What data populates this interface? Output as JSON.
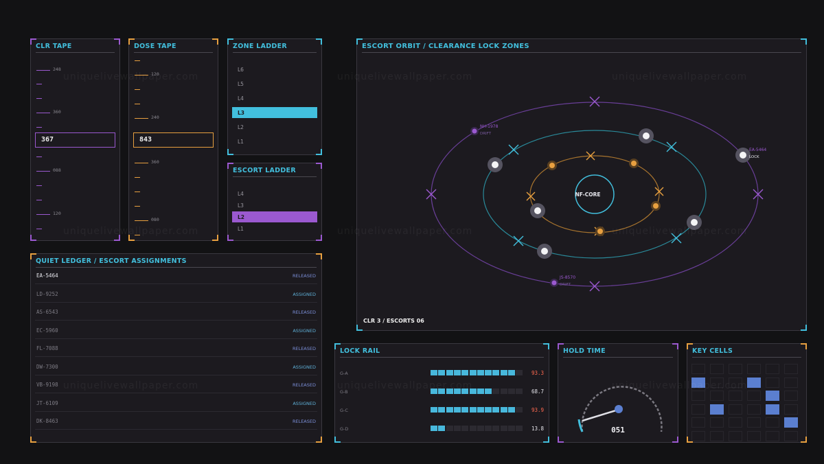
{
  "clr_tape": {
    "title": "CLR TAPE",
    "ticks": [
      "248",
      "",
      "",
      "360",
      "",
      "",
      "088",
      "",
      "",
      "120",
      "",
      ""
    ],
    "value": "367"
  },
  "dose_tape": {
    "title": "DOSE TAPE",
    "ticks_top": [
      "",
      "120",
      "",
      "",
      "240"
    ],
    "ticks_bottom": [
      "360",
      "",
      "",
      "",
      "080",
      ""
    ],
    "value": "843"
  },
  "zone_ladder": {
    "title": "ZONE LADDER",
    "levels": [
      "L6",
      "L5",
      "L4",
      "L3",
      "L2",
      "L1"
    ],
    "active": "L3"
  },
  "escort_ladder": {
    "title": "ESCORT LADDER",
    "levels": [
      "L4",
      "L3",
      "L2",
      "L1"
    ],
    "active": "L2"
  },
  "ledger": {
    "title": "QUIET LEDGER / ESCORT ASSIGNMENTS",
    "rows": [
      {
        "id": "EA-5464",
        "status": "RELEASED"
      },
      {
        "id": "LD-9252",
        "status": "ASSIGNED"
      },
      {
        "id": "AS-6543",
        "status": "RELEASED"
      },
      {
        "id": "EC-5960",
        "status": "ASSIGNED"
      },
      {
        "id": "FL-7088",
        "status": "RELEASED"
      },
      {
        "id": "DW-7300",
        "status": "ASSIGNED"
      },
      {
        "id": "VB-9198",
        "status": "RELEASED"
      },
      {
        "id": "JT-6109",
        "status": "ASSIGNED"
      },
      {
        "id": "DK-8463",
        "status": "RELEASED"
      }
    ]
  },
  "orbit": {
    "title": "ESCORT ORBIT / CLEARANCE LOCK ZONES",
    "core_label": "NF-CORE",
    "footer": "CLR 3 / ESCORTS 06",
    "tags": [
      {
        "id": "NH-1978",
        "state": "DRIFT"
      },
      {
        "id": "EA-5464",
        "state": "LOCK"
      },
      {
        "id": "JS-8570",
        "state": "DRIFT"
      }
    ]
  },
  "lock_rail": {
    "title": "LOCK RAIL",
    "rows": [
      {
        "label": "G-A",
        "value": "93.3",
        "filled": 11,
        "alert": true
      },
      {
        "label": "G-B",
        "value": "68.7",
        "filled": 8,
        "alert": false
      },
      {
        "label": "G-C",
        "value": "93.9",
        "filled": 11,
        "alert": true
      },
      {
        "label": "G-D",
        "value": "13.8",
        "filled": 2,
        "alert": false
      }
    ],
    "total_cells": 12
  },
  "hold_time": {
    "title": "HOLD TIME",
    "value": "051"
  },
  "key_cells": {
    "title": "KEY CELLS",
    "active": [
      [
        0,
        0
      ],
      [
        3,
        0
      ],
      [
        4,
        1
      ],
      [
        1,
        2
      ],
      [
        4,
        2
      ],
      [
        5,
        3
      ]
    ]
  },
  "watermark": "uniquelivewallpaper.com",
  "colors": {
    "purple": "#9b59d0",
    "orange": "#e8a040",
    "cyan": "#42bfdd",
    "alert": "#ff6a50",
    "keycell": "#5b7fd0"
  }
}
